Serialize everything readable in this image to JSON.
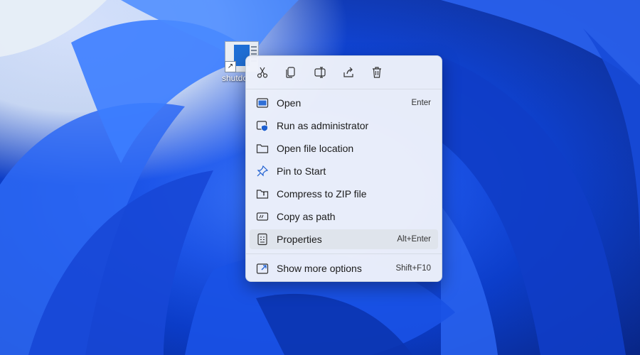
{
  "desktop": {
    "shortcut_label": "shutdo"
  },
  "context_menu": {
    "toolbar": [
      {
        "name": "cut-icon"
      },
      {
        "name": "copy-icon"
      },
      {
        "name": "rename-icon"
      },
      {
        "name": "share-icon"
      },
      {
        "name": "delete-icon"
      }
    ],
    "items": [
      {
        "label": "Open",
        "shortcut": "Enter",
        "icon": "open-icon"
      },
      {
        "label": "Run as administrator",
        "shortcut": "",
        "icon": "shield-icon"
      },
      {
        "label": "Open file location",
        "shortcut": "",
        "icon": "folder-icon"
      },
      {
        "label": "Pin to Start",
        "shortcut": "",
        "icon": "pin-icon"
      },
      {
        "label": "Compress to ZIP file",
        "shortcut": "",
        "icon": "zip-folder-icon"
      },
      {
        "label": "Copy as path",
        "shortcut": "",
        "icon": "copy-path-icon"
      },
      {
        "label": "Properties",
        "shortcut": "Alt+Enter",
        "icon": "properties-icon"
      }
    ],
    "more": {
      "label": "Show more options",
      "shortcut": "Shift+F10",
      "icon": "more-options-icon"
    }
  },
  "colors": {
    "wallpaper_blue": "#1e58f0",
    "menu_background": "#eef2fa",
    "hover_background": "#dfe4ec"
  }
}
